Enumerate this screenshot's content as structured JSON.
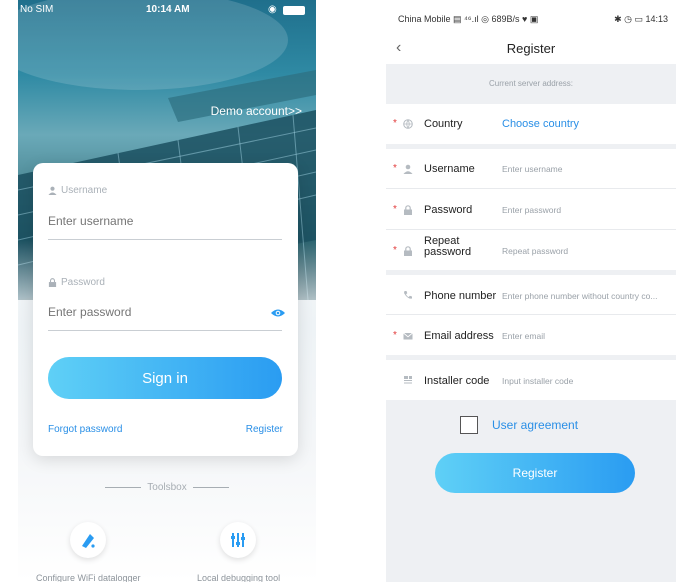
{
  "login": {
    "status": {
      "carrier": "No SIM",
      "time": "10:14 AM"
    },
    "demo_account": "Demo account>>",
    "username_label": "Username",
    "username_placeholder": "Enter username",
    "password_label": "Password",
    "password_placeholder": "Enter password",
    "sign_in": "Sign in",
    "forgot_password": "Forgot password",
    "register": "Register",
    "toolsbox": "Toolsbox",
    "tools": [
      {
        "label": "Configure WiFi datalogger",
        "icon": "wifi-config-icon"
      },
      {
        "label": "Local debugging tool",
        "icon": "debug-tool-icon"
      }
    ]
  },
  "register": {
    "status": {
      "left": "China Mobile ▤ ⁴⁶.ıl ◎ 689B/s ♥ ▣",
      "right": "✱ ◷ ▭ 14:13"
    },
    "title": "Register",
    "server_address": "Current server address:",
    "rows": [
      {
        "label": "Country",
        "value": "Choose country",
        "required": true,
        "icon": "globe-icon"
      },
      {
        "label": "Username",
        "value": "Enter username",
        "required": true,
        "icon": "user-icon"
      },
      {
        "label": "Password",
        "value": "Enter password",
        "required": true,
        "icon": "lock-icon"
      },
      {
        "label": "Repeat password",
        "value": "Repeat password",
        "required": true,
        "icon": "lock-icon"
      },
      {
        "label": "Phone number",
        "value": "Enter phone number without country co...",
        "required": false,
        "icon": "phone-icon"
      },
      {
        "label": "Email address",
        "value": "Enter email",
        "required": true,
        "icon": "mail-icon"
      },
      {
        "label": "Installer code",
        "value": "Input installer code",
        "required": false,
        "icon": "installer-icon"
      }
    ],
    "agreement": "User agreement",
    "register_button": "Register"
  },
  "colors": {
    "accent": "#2a8fe6",
    "required": "#e23b3b",
    "button_start": "#5fd0f6",
    "button_end": "#2a9cf2"
  }
}
